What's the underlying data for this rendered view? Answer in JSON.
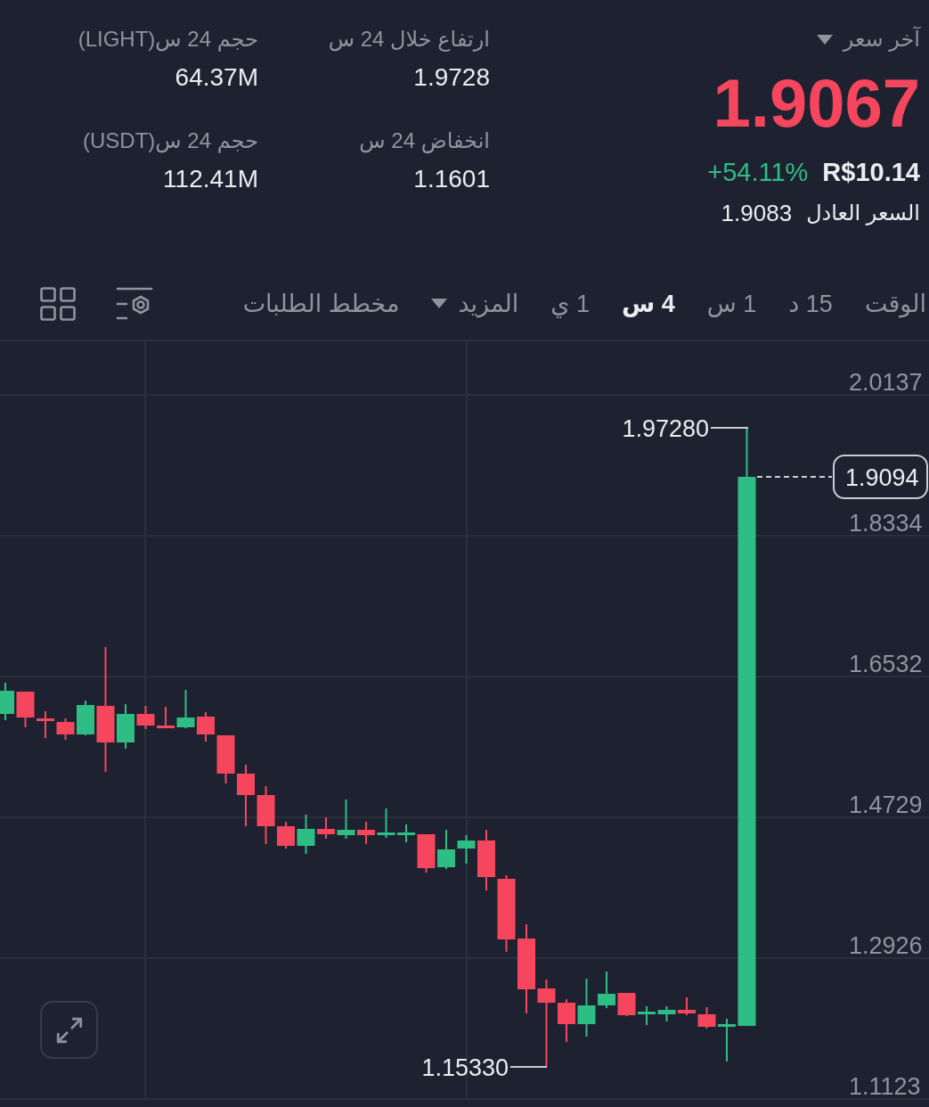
{
  "price_panel": {
    "label": "آخر سعر",
    "last_price": "1.9067",
    "falling": true,
    "local_price": "R$10.14",
    "change": "+54.11%",
    "change_positive": true,
    "fair_price_label": "السعر العادل",
    "fair_price": "1.9083"
  },
  "stats": [
    {
      "label": "ارتفاع خلال 24 س",
      "value": "1.9728"
    },
    {
      "label": "حجم 24 س(LIGHT)",
      "value": "64.37M"
    },
    {
      "label": "انخفاض 24 س",
      "value": "1.1601"
    },
    {
      "label": "حجم 24 س(USDT)",
      "value": "112.41M"
    }
  ],
  "toolbar": {
    "tabs": [
      {
        "kind": "tab",
        "label": "الوقت",
        "selected": false
      },
      {
        "kind": "tab",
        "label": "15 د",
        "selected": false
      },
      {
        "kind": "tab",
        "label": "1 س",
        "selected": false
      },
      {
        "kind": "tab",
        "label": "4 س",
        "selected": true
      },
      {
        "kind": "tab",
        "label": "1 ي",
        "selected": false
      },
      {
        "kind": "dropdown",
        "label": "المزيد",
        "selected": false
      },
      {
        "kind": "tab",
        "label": "مخطط الطلبات",
        "selected": false
      }
    ]
  },
  "chart": {
    "y_axis_labels": [
      "2.0137",
      "1.8334",
      "1.6532",
      "1.4729",
      "1.2926",
      "1.1123"
    ],
    "high_label": "1.97280",
    "low_label": "1.15330",
    "current_price": "1.9094"
  }
}
